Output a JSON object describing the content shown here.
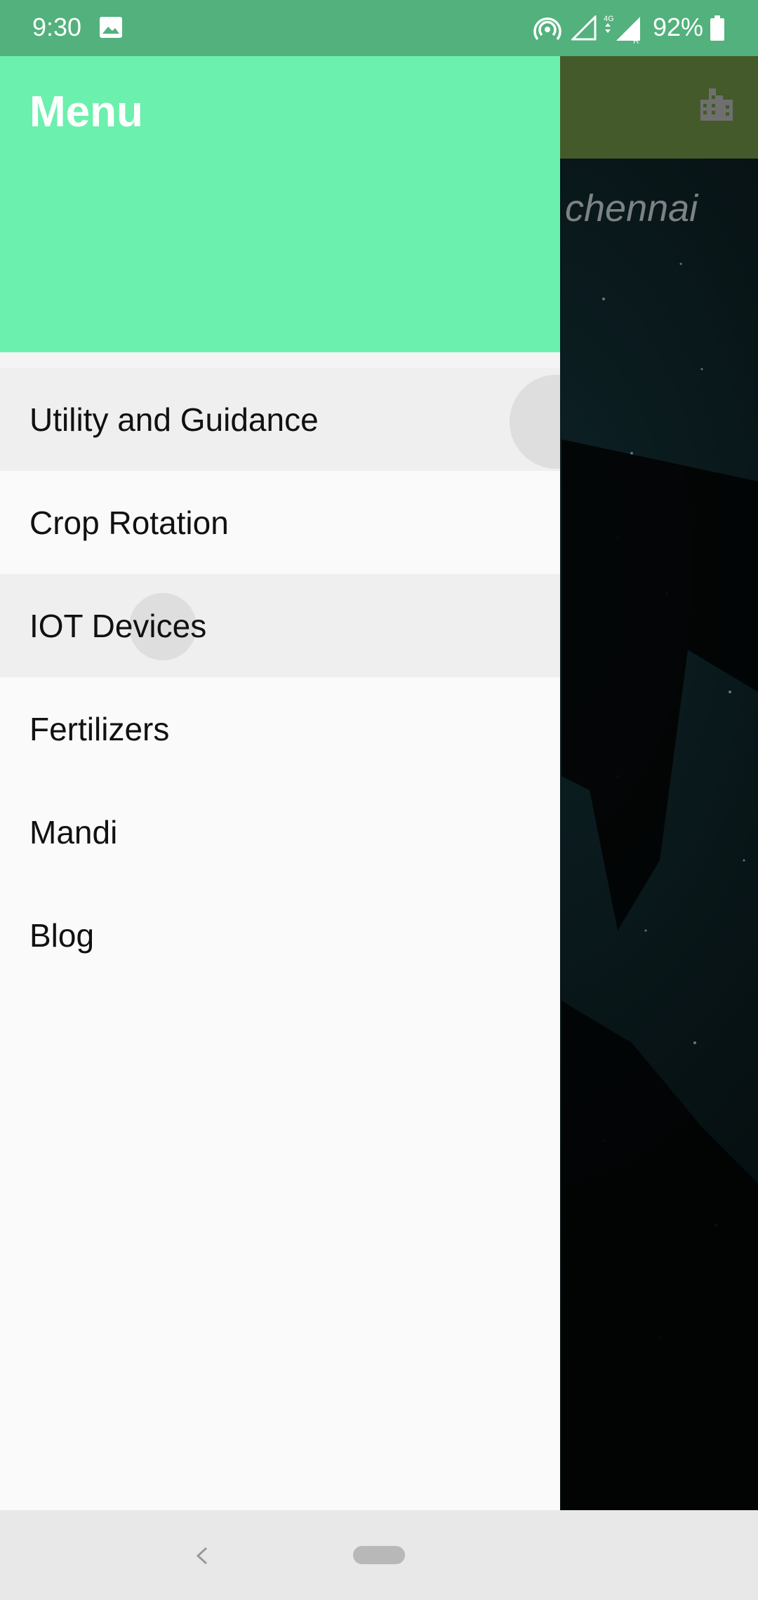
{
  "status_bar": {
    "time": "9:30",
    "battery": "92%",
    "icons": [
      "image-icon",
      "hotspot-icon",
      "signal-empty-icon",
      "data-arrows-icon",
      "cell-signal-icon",
      "battery-icon"
    ]
  },
  "background": {
    "city": "chennai",
    "appbar_icon": "city-icon"
  },
  "drawer": {
    "title": "Menu",
    "items": [
      {
        "label": "Utility and Guidance"
      },
      {
        "label": "Crop Rotation"
      },
      {
        "label": "IOT Devices"
      },
      {
        "label": "Fertilizers"
      },
      {
        "label": "Mandi"
      },
      {
        "label": "Blog"
      }
    ]
  },
  "colors": {
    "status_bar": "#52b17c",
    "drawer_header": "#6cf0ad",
    "drawer_bg": "#fafafa",
    "appbar_bg": "#445a2a"
  },
  "nav_bar": {
    "icons": [
      "back-icon",
      "home-pill-icon"
    ]
  }
}
